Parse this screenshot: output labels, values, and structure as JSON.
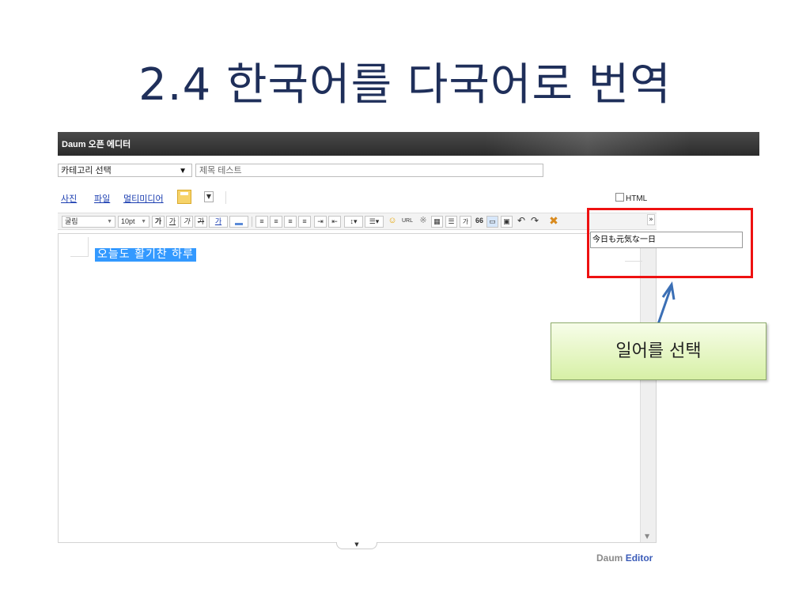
{
  "slide": {
    "title": "2.4 한국어를 다국어로 번역"
  },
  "editor": {
    "title": "Daum 오픈 에디터",
    "category": {
      "value": "카테고리 선택"
    },
    "subject": {
      "value": "제목 테스트"
    },
    "attach": {
      "photo": "사진",
      "file": "파일",
      "media": "멀티미디어"
    },
    "html_label": "HTML",
    "toolbar": {
      "font": "굴림",
      "size": "10pt",
      "bold": "가",
      "underline": "가",
      "italic": "가",
      "strike": "가",
      "color": "가",
      "url": "URL",
      "hanja": "가",
      "quote": "66"
    },
    "content_text": "오늘도 활기찬 하루",
    "brand_prefix": "Daum",
    "brand_strong": "Editor"
  },
  "translation": {
    "value": "今日も元気な一日"
  },
  "callout": {
    "text": "일어를 선택"
  },
  "colors": {
    "annotation": "#ee1111",
    "link": "#1a3db0",
    "selection": "#3399ff",
    "title": "#1f2f5a"
  }
}
